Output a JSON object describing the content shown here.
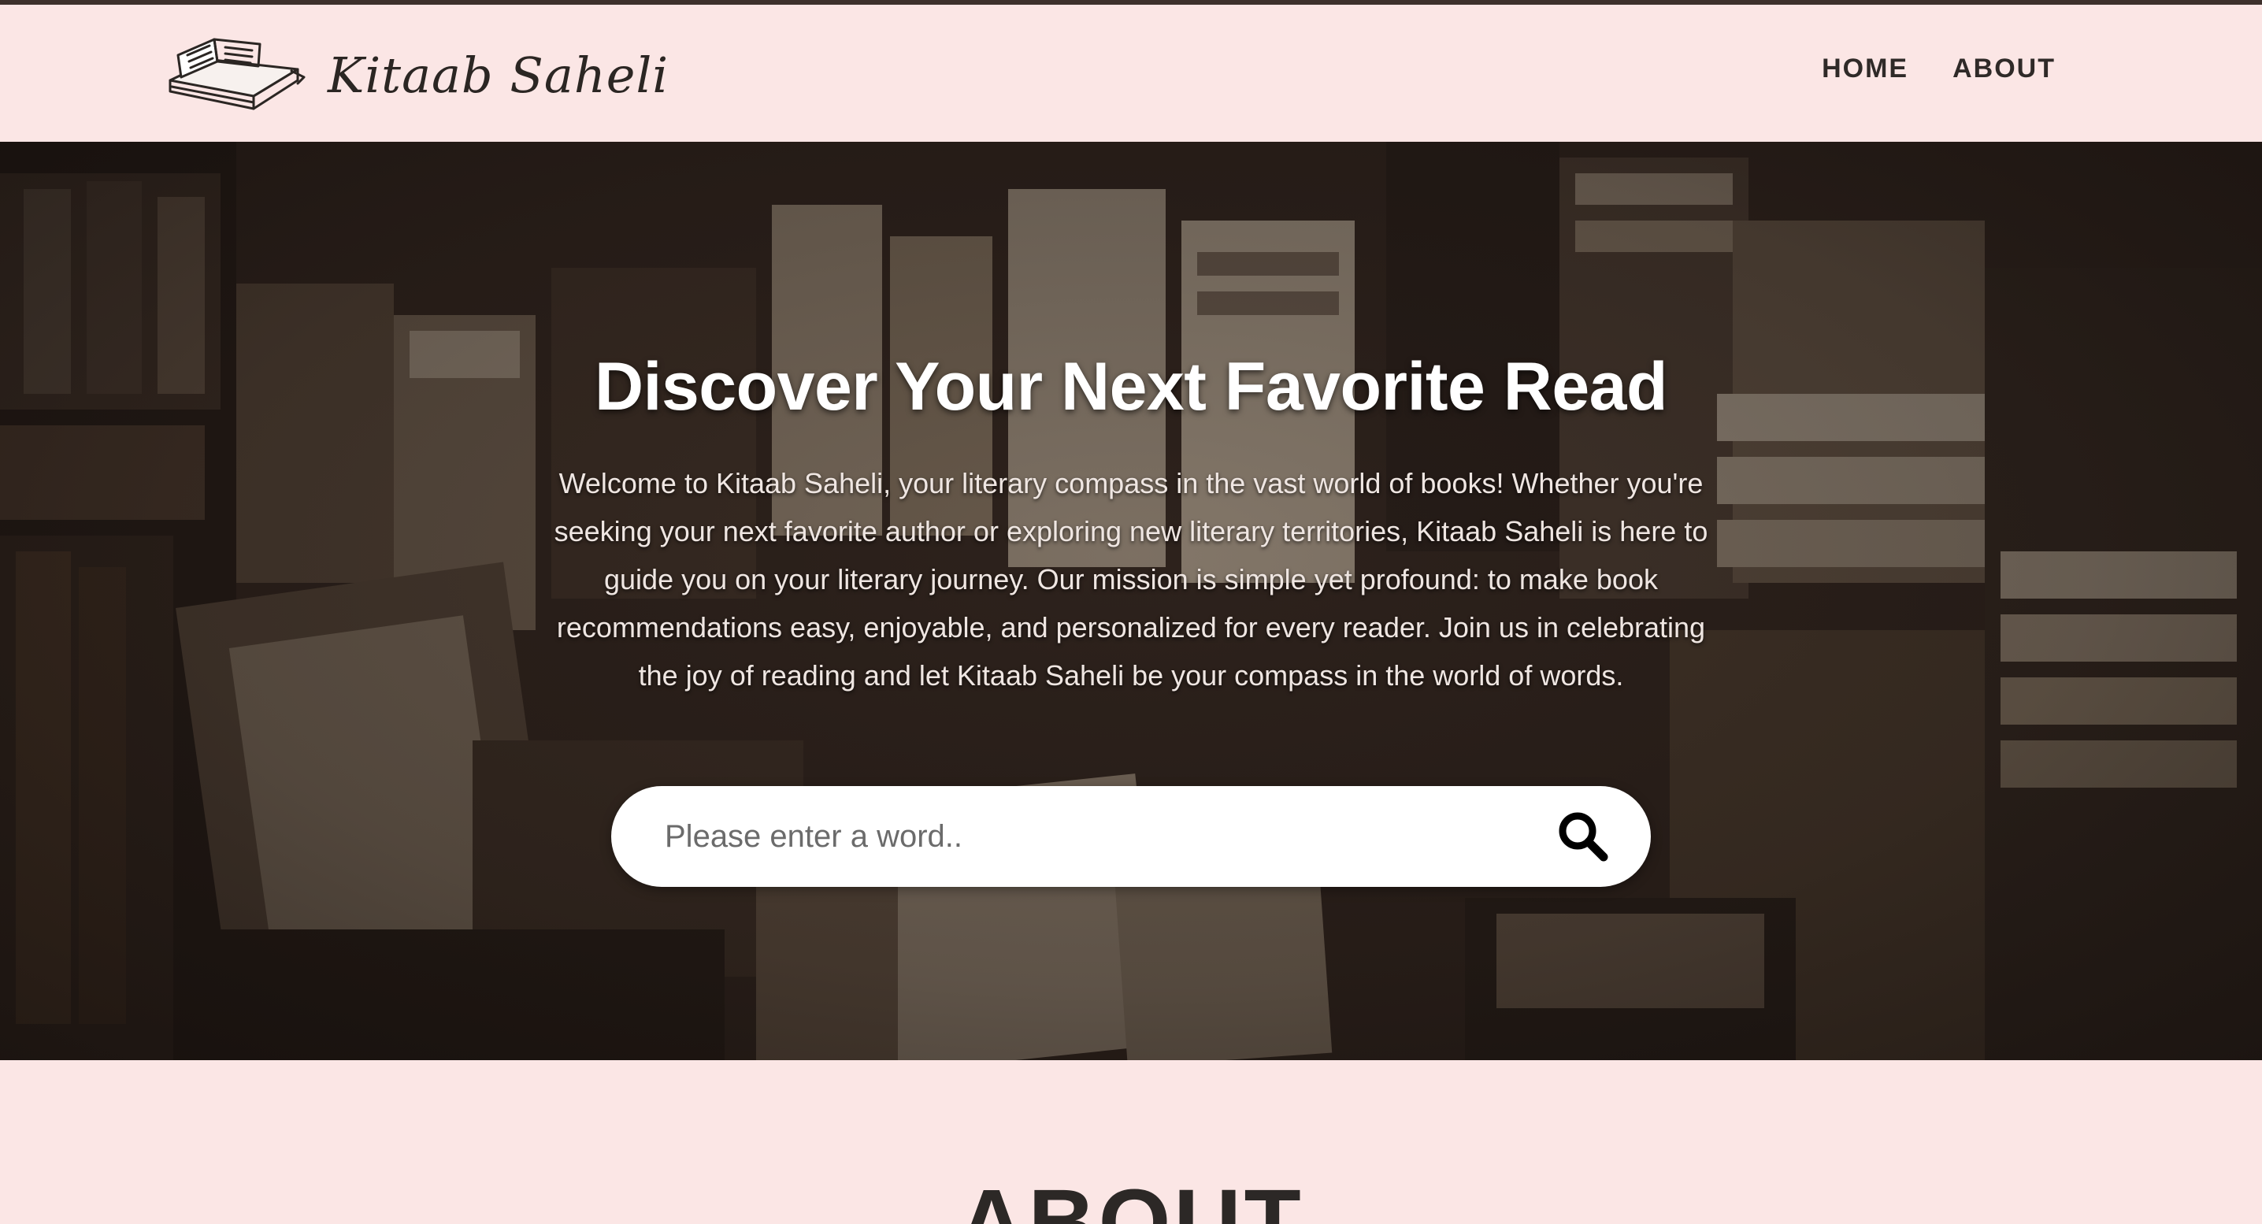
{
  "brand": {
    "name": "Kitaab Saheli",
    "logo_icon": "open-book-icon"
  },
  "nav": {
    "home_label": "HOME",
    "about_label": "ABOUT"
  },
  "hero": {
    "title": "Discover Your Next Favorite Read",
    "description": "Welcome to Kitaab Saheli, your literary compass in the vast world of books! Whether you're seeking your next favorite author or exploring new literary territories, Kitaab Saheli is here to guide you on your literary journey. Our mission is simple yet profound: to make book recommendations easy, enjoyable, and personalized for every reader. Join us in celebrating the joy of reading and let Kitaab Saheli be your compass in the world of words.",
    "background_image": "bookshelves-photo"
  },
  "search": {
    "placeholder": "Please enter a word..",
    "value": "",
    "icon": "search-icon"
  },
  "about": {
    "heading": "ABOUT"
  },
  "colors": {
    "page_background": "#fbe6e5",
    "top_strip": "#3d302c",
    "text_dark": "#2c2826",
    "hero_title": "#ffffff"
  }
}
